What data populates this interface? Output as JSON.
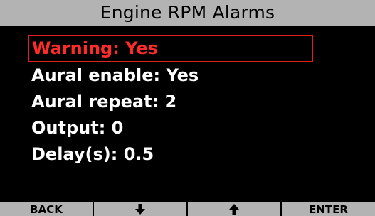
{
  "title": "Engine RPM Alarms",
  "menu": {
    "items": [
      {
        "label": "Warning: Yes",
        "selected": true
      },
      {
        "label": "Aural enable: Yes",
        "selected": false
      },
      {
        "label": "Aural repeat: 2",
        "selected": false
      },
      {
        "label": "Output: 0",
        "selected": false
      },
      {
        "label": "Delay(s): 0.5",
        "selected": false
      }
    ]
  },
  "softkeys": {
    "back": "BACK",
    "down_icon": "arrow-down-icon",
    "up_icon": "arrow-up-icon",
    "enter": "ENTER"
  },
  "colors": {
    "selected": "#ff2a2a",
    "bar": "#b3b3b3",
    "background": "#000000",
    "text": "#ffffff"
  }
}
